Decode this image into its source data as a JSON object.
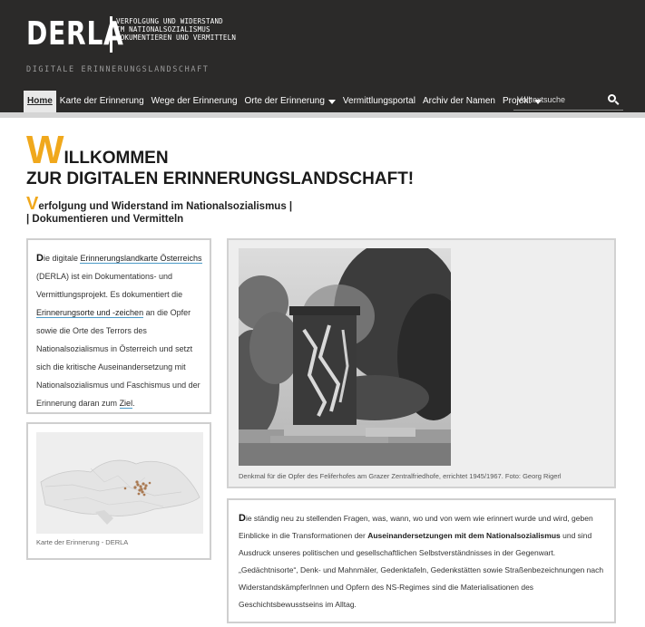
{
  "header": {
    "logo": "DERLA",
    "tagline": [
      "VERFOLGUNG UND WIDERSTAND",
      "IM NATIONALSOZIALISMUS",
      "DOKUMENTIEREN UND VERMITTELN"
    ],
    "subtitle": "DIGITALE ERINNERUNGSLANDSCHAFT"
  },
  "nav": {
    "items": [
      {
        "label": "Home"
      },
      {
        "label": "Karte der Erinnerung"
      },
      {
        "label": "Wege der Erinnerung"
      },
      {
        "label": "Orte der Erinnerung"
      },
      {
        "label": "Vermittlungsportal"
      },
      {
        "label": "Archiv der Namen"
      },
      {
        "label": "Projekt"
      }
    ]
  },
  "search": {
    "placeholder": "Volltextsuche"
  },
  "welcome": {
    "first_letter": "W",
    "rest": "ILLKOMMEN",
    "line2": "ZUR DIGITALEN ERINNERUNGSLANDSCHAFT!"
  },
  "subhead": {
    "first_letter": "V",
    "line1_rest": "erfolgung und Widerstand im Nationalsozialismus |",
    "line2": "| Dokumentieren und Vermitteln"
  },
  "intro": {
    "dropcap": "D",
    "t1": "ie digitale ",
    "link1": "Erinnerungslandkarte Österreichs",
    "t2": " (DERLA) ist ein Dokumentations- und Vermittlungsprojekt. Es dokumentiert die ",
    "link2": "Erinnerungsorte und -zeichen",
    "t3": " an die Opfer sowie die Orte des Terrors des Nationalsozialismus in Österreich und setzt sich die kritische Auseinandersetzung mit Nationalsozialismus und Faschismus und der Erinnerung daran zum ",
    "link3": "Ziel",
    "t4": "."
  },
  "map": {
    "caption": "Karte der Erinnerung - DERLA"
  },
  "photo": {
    "caption": "Denkmal für die Opfer des Feliferhofes am Grazer Zentralfriedhofe, errichtet 1945/1967. Foto: Georg Rigerl"
  },
  "text": {
    "dropcap": "D",
    "t1": "ie ständig neu zu stellenden Fragen, was, wann, wo und von wem wie erinnert wurde und wird, geben Einblicke in die Transformationen der ",
    "bold": "Auseinandersetzungen mit dem Nationalsozialismus",
    "t2": " und sind Ausdruck unseres politischen und gesellschaftlichen Selbstverständnisses in der Gegenwart. „Gedächtnisorte“, Denk- und Mahnmäler, Gedenktafeln, Gedenkstätten sowie Straßenbezeichnungen nach WiderstandskämpferInnen und Opfern des NS-Regimes sind die Materialisationen des Geschichtsbewusstseins im Alltag."
  }
}
